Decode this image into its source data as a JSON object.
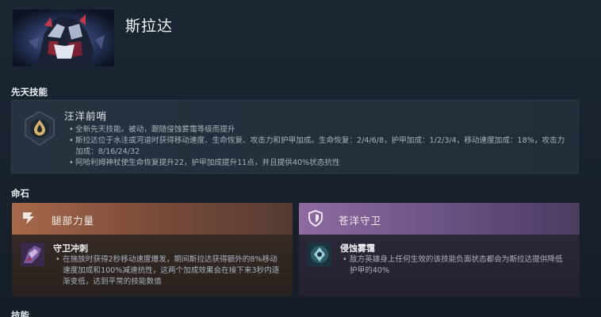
{
  "hero": {
    "name": "斯拉达"
  },
  "innate": {
    "section_title": "先天技能",
    "ability_name": "汪洋前哨",
    "icon": "water-drop-shield-icon",
    "bullets": [
      "全新先天技能。被动，跟随侵蚀雾霭等级而提升",
      "斯拉达位于水洼或河道时获得移动速度、生命恢复、攻击力和护甲加成。生命恢复：2/4/6/8，护甲加成：1/2/3/4，移动速度加成：18%，攻击力加成：8/16/24/32",
      "阿哈利姆神杖使生命恢复提升22，护甲加成提升11点，并且提供40%状态抗性"
    ]
  },
  "facets": {
    "section_title": "命石",
    "left": {
      "name": "腿部力量",
      "icon": "speed-lines-icon",
      "ability_name": "守卫冲刺",
      "ability_icon": "guardian-sprint-icon",
      "description": [
        "在施放时获得2秒移动速度爆发，期间斯拉达获得额外的8%移动速度加成和100%减速抗性，这两个加成效果会在接下来3秒内逐渐变低，达到平常的技能数值"
      ]
    },
    "right": {
      "name": "苍洋守卫",
      "icon": "shield-icon",
      "ability_name": "侵蚀雾霭",
      "ability_icon": "corrosive-haze-icon",
      "description": [
        "敌方英雄身上任何生效的该技能负面状态都会为斯拉达提供降低护甲的40%"
      ]
    }
  },
  "abilities": {
    "section_title": "技能"
  },
  "colors": {
    "background": "#1c2633",
    "facet_left_accent": "#a7684a",
    "facet_right_accent": "#8e6aa1"
  }
}
